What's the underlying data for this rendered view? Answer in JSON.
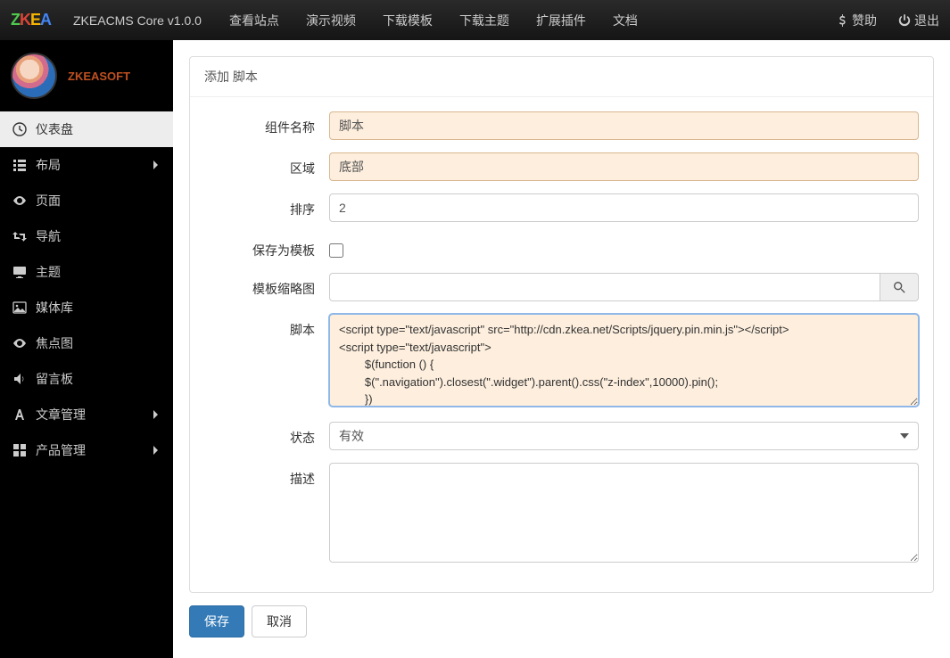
{
  "brand": {
    "z": "Z",
    "k": "K",
    "e": "E",
    "a": "A"
  },
  "topbar": {
    "product": "ZKEACMS Core v1.0.0",
    "nav": [
      "查看站点",
      "演示视频",
      "下载模板",
      "下载主题",
      "扩展插件",
      "文档"
    ],
    "sponsor": "赞助",
    "logout": "退出"
  },
  "user": {
    "name": "ZKEASOFT"
  },
  "sidebar": {
    "items": [
      {
        "label": "仪表盘",
        "icon": "clock",
        "active": true
      },
      {
        "label": "布局",
        "icon": "list",
        "chev": true
      },
      {
        "label": "页面",
        "icon": "eye"
      },
      {
        "label": "导航",
        "icon": "retweet"
      },
      {
        "label": "主题",
        "icon": "display"
      },
      {
        "label": "媒体库",
        "icon": "image"
      },
      {
        "label": "焦点图",
        "icon": "eye"
      },
      {
        "label": "留言板",
        "icon": "sound"
      },
      {
        "label": "文章管理",
        "icon": "letter-a",
        "chev": true
      },
      {
        "label": "产品管理",
        "icon": "grid",
        "chev": true
      }
    ]
  },
  "panel": {
    "title": "添加 脚本",
    "labels": {
      "component_name": "组件名称",
      "zone": "区域",
      "order": "排序",
      "save_as_template": "保存为模板",
      "template_thumb": "模板缩略图",
      "script": "脚本",
      "status": "状态",
      "description": "描述"
    },
    "values": {
      "component_name": "脚本",
      "zone": "底部",
      "order": "2",
      "save_as_template": false,
      "template_thumb": "",
      "script": "<script type=\"text/javascript\" src=\"http://cdn.zkea.net/Scripts/jquery.pin.min.js\"></script>\n<script type=\"text/javascript\">\n        $(function () {\n        $(\".navigation\").closest(\".widget\").parent().css(\"z-index\",10000).pin();\n        })",
      "status": "有效",
      "description": ""
    },
    "actions": {
      "save": "保存",
      "cancel": "取消"
    }
  }
}
